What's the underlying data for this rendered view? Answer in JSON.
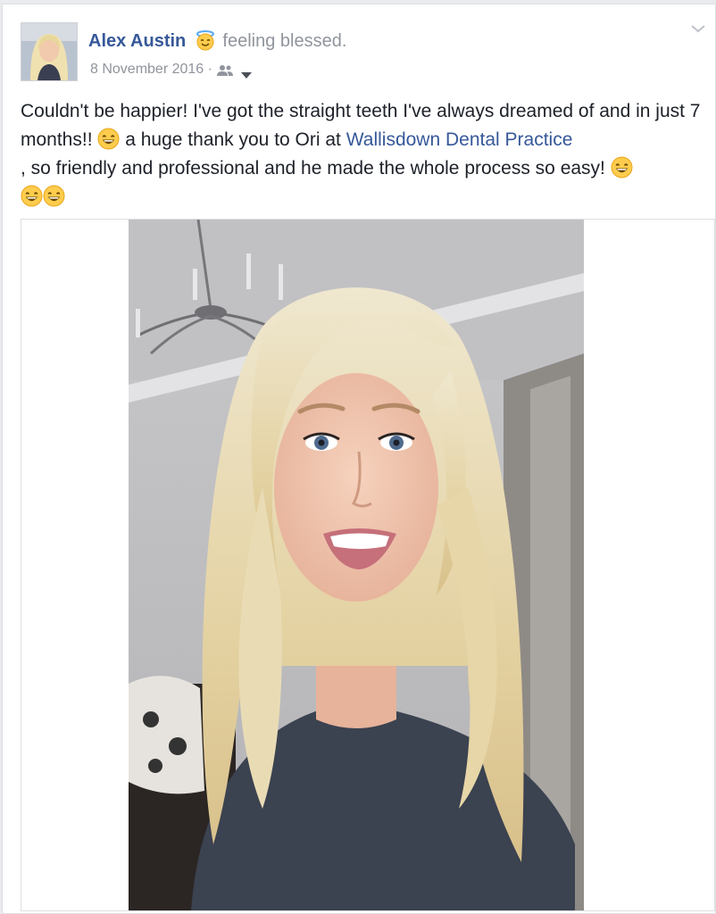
{
  "post": {
    "author": "Alex Austin",
    "feeling_icon": "smiling-face-with-halo-icon",
    "feeling": "feeling blessed.",
    "date": "8 November 2016",
    "separator": "·",
    "audience_icon": "friends-icon",
    "text_part1": "Couldn't be happier! I've got the straight teeth I've always dreamed of and in just 7 months!!",
    "text_part2": "a huge thank you to Ori at",
    "link_text": "Wallisdown Dental Practice",
    "text_part3": ", so friendly and professional and he made the whole process so easy!",
    "emoji": "grinning-face-with-smiling-eyes-icon",
    "photo_icon": "selfie-photo"
  },
  "colors": {
    "link": "#365899",
    "meta": "#90949c",
    "text": "#1d2129",
    "background": "#e9ebee"
  }
}
